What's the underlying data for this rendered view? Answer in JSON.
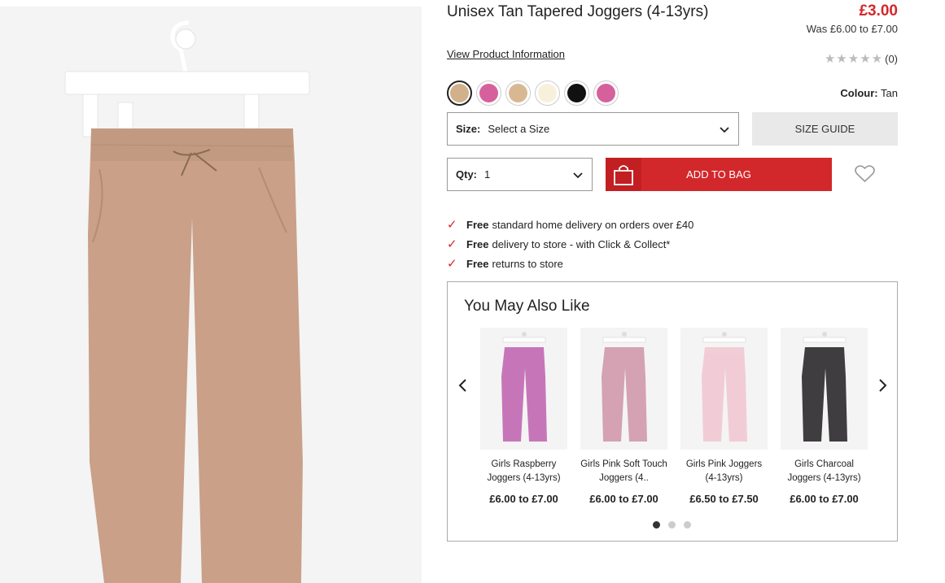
{
  "product": {
    "title": "Unisex Tan Tapered Joggers (4-13yrs)",
    "price": "£3.00",
    "was_price": "Was £6.00 to £7.00",
    "view_info_link": "View Product Information",
    "rating_count": "(0)",
    "colour_label": "Colour:",
    "colour_value": "Tan",
    "image_colour": "#caa088"
  },
  "swatches": [
    {
      "name": "tan",
      "color": "#d2b08c",
      "selected": true
    },
    {
      "name": "pink",
      "color": "#d6609c",
      "selected": false
    },
    {
      "name": "beige",
      "color": "#d8b893",
      "selected": false
    },
    {
      "name": "cream",
      "color": "#f7f1dc",
      "selected": false
    },
    {
      "name": "black",
      "color": "#111111",
      "selected": false
    },
    {
      "name": "pink-2",
      "color": "#d6609c",
      "selected": false
    }
  ],
  "size": {
    "label": "Size:",
    "value": "Select a Size"
  },
  "size_guide_label": "SIZE GUIDE",
  "qty": {
    "label": "Qty:",
    "value": "1"
  },
  "add_to_bag_label": "ADD TO BAG",
  "perks": [
    {
      "bold": "Free",
      "text": "standard home delivery on orders over £40"
    },
    {
      "bold": "Free",
      "text": "delivery to store - with Click & Collect*"
    },
    {
      "bold": "Free",
      "text": "returns to store"
    }
  ],
  "recommendations": {
    "heading": "You May Also Like",
    "items": [
      {
        "name": "Girls Raspberry Joggers (4-13yrs)",
        "price": "£6.00 to £7.00",
        "color": "#c676b8"
      },
      {
        "name": "Girls Pink Soft Touch Joggers (4..",
        "price": "£6.00 to £7.00",
        "color": "#d4a2b2"
      },
      {
        "name": "Girls Pink Joggers (4-13yrs)",
        "price": "£6.50 to £7.50",
        "color": "#f1ccd6"
      },
      {
        "name": "Girls Charcoal Joggers (4-13yrs)",
        "price": "£6.00 to £7.00",
        "color": "#3f3d3f"
      }
    ]
  },
  "colors": {
    "accent_red": "#d3282b"
  }
}
